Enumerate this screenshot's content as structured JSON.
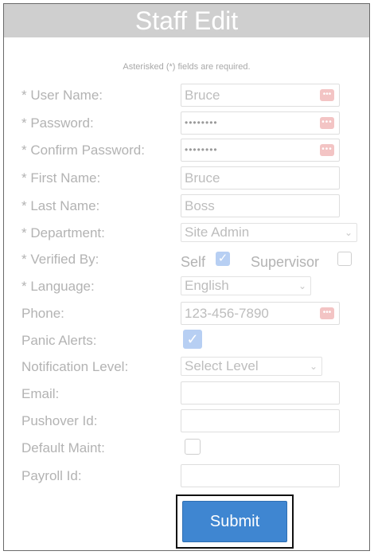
{
  "header": {
    "title": "Staff Edit"
  },
  "form": {
    "required_note": "Asterisked (*) fields are required.",
    "labels": {
      "username": "* User Name:",
      "password": "* Password:",
      "confirm_password": "* Confirm Password:",
      "first_name": "* First Name:",
      "last_name": "* Last Name:",
      "department": "* Department:",
      "verified_by": "* Verified By:",
      "language": "* Language:",
      "phone": "Phone:",
      "panic_alerts": "Panic Alerts:",
      "notification_level": "Notification Level:",
      "email": "Email:",
      "pushover_id": "Pushover Id:",
      "default_maint": "Default Maint:",
      "payroll_id": "Payroll Id:"
    },
    "values": {
      "username": "Bruce",
      "password": "••••••••",
      "confirm_password": "••••••••",
      "first_name": "Bruce",
      "last_name": "Boss",
      "department": "Site Admin",
      "language": "English",
      "phone": "123-456-7890",
      "notification_level": "Select Level",
      "email": "",
      "pushover_id": "",
      "payroll_id": ""
    },
    "verified_options": {
      "self_label": "Self",
      "self_checked": true,
      "supervisor_label": "Supervisor",
      "supervisor_checked": false
    },
    "checkboxes": {
      "panic_alerts": true,
      "default_maint": false
    },
    "key_icon_glyph": "•••",
    "chevron_glyph": "⌄",
    "check_glyph": "✓"
  },
  "actions": {
    "submit_label": "Submit"
  },
  "colors": {
    "accent": "#3f86d1",
    "title_bar": "#cfcfcf"
  }
}
